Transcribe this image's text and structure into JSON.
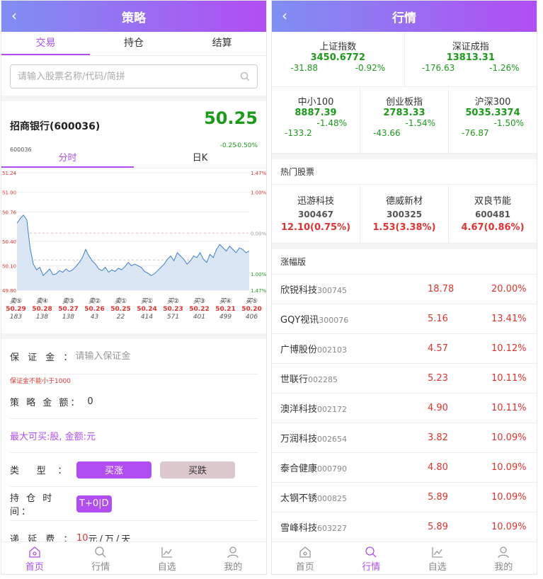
{
  "left": {
    "title": "策略",
    "back_icon": "‹",
    "tabs": [
      "交易",
      "持仓",
      "结算"
    ],
    "search_placeholder": "请输入股票名称/代码/简拼",
    "stock": {
      "name": "招商银行(600036)",
      "price": "50.25",
      "change": "-0.25",
      "change_pct": "-0.50%",
      "code": "600036"
    },
    "ktabs": [
      "分时",
      "日K"
    ],
    "chart_data": {
      "type": "line",
      "title": "",
      "y_left_ticks": [
        "51.24",
        "51.00",
        "50.76",
        "50.40",
        "50.10",
        "49.80"
      ],
      "y_right_ticks": [
        "1.47%",
        "1.00%",
        "0.00%",
        "1.00%",
        "1.47%"
      ],
      "values": [
        50.62,
        50.68,
        50.72,
        50.66,
        50.32,
        50.12,
        50.05,
        50.08,
        49.98,
        50.02,
        50.06,
        49.99,
        50.0,
        50.04,
        50.02,
        50.06,
        50.03,
        50.05,
        50.09,
        50.14,
        50.2,
        50.3,
        50.22,
        50.16,
        50.12,
        50.06,
        50.04,
        50.08,
        50.02,
        50.05,
        50.03,
        50.07,
        50.05,
        50.09,
        50.14,
        50.1,
        50.12,
        50.1,
        50.08,
        50.03,
        50.01,
        49.98,
        50.0,
        50.04,
        50.08,
        50.12,
        50.18,
        50.22,
        50.16,
        50.26,
        50.22,
        50.18,
        50.12,
        50.16,
        50.22,
        50.2,
        50.26,
        50.18,
        50.14,
        50.24,
        50.2,
        50.3,
        50.36,
        50.32,
        50.28,
        50.34,
        50.3,
        50.26,
        50.32,
        50.3,
        50.26,
        50.28
      ],
      "ylim": [
        49.8,
        51.24
      ]
    },
    "orders": [
      {
        "label": "卖⑤",
        "price": "50.29",
        "vol": "183"
      },
      {
        "label": "卖④",
        "price": "50.28",
        "vol": "138"
      },
      {
        "label": "卖③",
        "price": "50.27",
        "vol": "138"
      },
      {
        "label": "卖②",
        "price": "50.26",
        "vol": "43"
      },
      {
        "label": "卖①",
        "price": "50.25",
        "vol": "22"
      },
      {
        "label": "买①",
        "price": "50.24",
        "vol": "414"
      },
      {
        "label": "买②",
        "price": "50.23",
        "vol": "571"
      },
      {
        "label": "买③",
        "price": "50.22",
        "vol": "401"
      },
      {
        "label": "买④",
        "price": "50.21",
        "vol": "499"
      },
      {
        "label": "买⑤",
        "price": "50.20",
        "vol": "406"
      }
    ],
    "margin_label": "保 证 金 ：",
    "margin_placeholder": "请输入保证金",
    "margin_warn": "保证金不能小于1000",
    "strategy_label": "策 略 金 额：",
    "strategy_value": "0",
    "maxbuy": "最大可买:股, 金额:元",
    "type_label": "类      型    ：",
    "buy_up": "买涨",
    "buy_down": "买跌",
    "hold_label": "持 仓 时 间：",
    "hold_value": "T+0|D",
    "fee_label": "递 延 费 ：",
    "fee_value": "10",
    "fee_unit": "元/万/天",
    "tabbar": [
      "首页",
      "行情",
      "自选",
      "我的"
    ]
  },
  "right": {
    "title": "行情",
    "back_icon": "‹",
    "indices_top": [
      {
        "name": "上证指数",
        "value": "3450.6772",
        "chg": "-31.88",
        "pct": "-0.92%"
      },
      {
        "name": "深证成指",
        "value": "13813.31",
        "chg": "-176.63",
        "pct": "-1.26%"
      }
    ],
    "indices_mid": [
      {
        "name": "中小100",
        "value": "8887.39",
        "pct": "-1.48%",
        "chg": "-133.2"
      },
      {
        "name": "创业板指",
        "value": "2783.33",
        "pct": "-1.54%",
        "chg": "-43.66"
      },
      {
        "name": "沪深300",
        "value": "5035.3374",
        "pct": "-1.50%",
        "chg": "-76.87"
      }
    ],
    "hot_title": "热门股票",
    "hot": [
      {
        "name": "迅游科技",
        "code": "300467",
        "price": "12.10(0.75%)"
      },
      {
        "name": "德威新材",
        "code": "300325",
        "price": "1.53(3.38%)"
      },
      {
        "name": "双良节能",
        "code": "600481",
        "price": "4.67(0.86%)"
      }
    ],
    "list_title": "涨幅版",
    "list": [
      {
        "name": "欣锐科技",
        "code": "300745",
        "price": "18.78",
        "pct": "20.00%"
      },
      {
        "name": "GQY视讯",
        "code": "300076",
        "price": "5.16",
        "pct": "13.41%"
      },
      {
        "name": "广博股份",
        "code": "002103",
        "price": "4.57",
        "pct": "10.12%"
      },
      {
        "name": "世联行",
        "code": "002285",
        "price": "5.23",
        "pct": "10.11%"
      },
      {
        "name": "澳洋科技",
        "code": "002172",
        "price": "4.90",
        "pct": "10.11%"
      },
      {
        "name": "万润科技",
        "code": "002654",
        "price": "3.82",
        "pct": "10.09%"
      },
      {
        "name": "泰合健康",
        "code": "000790",
        "price": "4.80",
        "pct": "10.09%"
      },
      {
        "name": "太钢不锈",
        "code": "000825",
        "price": "5.89",
        "pct": "10.09%"
      },
      {
        "name": "雪峰科技",
        "code": "603227",
        "price": "5.89",
        "pct": "10.09%"
      }
    ],
    "tabbar": [
      "首页",
      "行情",
      "自选",
      "我的"
    ]
  },
  "colors": {
    "accent": "#b14ef2",
    "green": "#1a9b1a",
    "red": "#e0332e",
    "header_start": "#7f8ff3",
    "header_end": "#b14ef2"
  }
}
